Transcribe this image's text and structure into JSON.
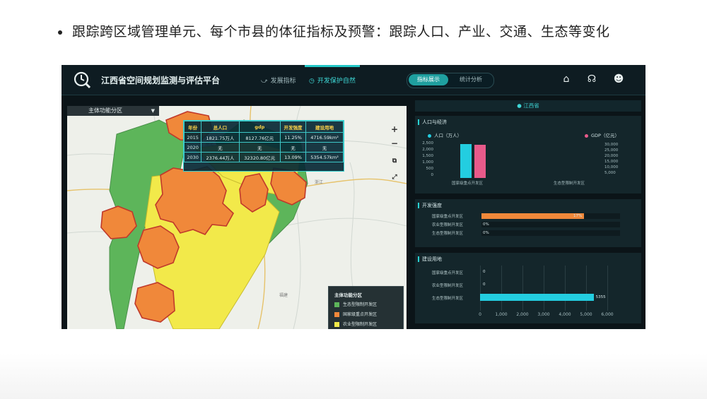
{
  "slide": {
    "bullet_text": "跟踪跨区域管理单元、每个市县的体征指标及预警：跟踪人口、产业、交通、生态等变化"
  },
  "app": {
    "title": "江西省空间规划监测与评估平台",
    "nav_tabs": [
      {
        "label": "发展指标",
        "icon": "trend-icon",
        "active": false
      },
      {
        "label": "开发保护自然",
        "icon": "clock-icon",
        "active": true
      }
    ],
    "segments": [
      {
        "label": "指标展示",
        "active": true
      },
      {
        "label": "统计分析",
        "active": false
      }
    ],
    "top_icons": [
      "home-icon",
      "support-icon",
      "user-icon"
    ],
    "colors": {
      "accent": "#23c7c7",
      "green": "#5db55a",
      "orange": "#f0883a",
      "yellow": "#f2e94a",
      "pink": "#e85a8a",
      "cyan": "#23cde0"
    }
  },
  "map": {
    "layer_select": "主体功能分区",
    "controls": [
      "+",
      "−"
    ],
    "table": {
      "headers": [
        "年份",
        "总人口",
        "gdp",
        "开发强度",
        "建设用地"
      ],
      "rows": [
        [
          "2015",
          "1821.75万人",
          "8127.76亿元",
          "11.25%",
          "4716.59km²"
        ],
        [
          "2020",
          "无",
          "无",
          "无",
          "无"
        ],
        [
          "2030",
          "2376.44万人",
          "32320.80亿元",
          "13.09%",
          "5354.57km²"
        ]
      ]
    },
    "legend": {
      "title": "主体功能分区",
      "items": [
        {
          "label": "生态型限制开发区",
          "color": "#5db55a"
        },
        {
          "label": "国家级重点开发区",
          "color": "#f0883a"
        },
        {
          "label": "农业型限制开发区",
          "color": "#f2e94a"
        }
      ]
    }
  },
  "right_panel": {
    "region": "江西省",
    "population_panel": {
      "title": "人口与经济",
      "legend_left": "人口（万人）",
      "legend_right": "GDP（亿元）",
      "y_left_ticks": [
        "2,500",
        "2,000",
        "1,500",
        "1,000",
        "500",
        "0"
      ],
      "y_right_ticks": [
        "30,000",
        "25,000",
        "20,000",
        "15,000",
        "10,000",
        "5,000"
      ],
      "x_labels": [
        "国家级重点开发区",
        "生态型限制开发区"
      ]
    },
    "dev_panel": {
      "title": "开发强度",
      "rows": [
        {
          "label": "国家级重点开发区",
          "value": "17%"
        },
        {
          "label": "农业型限制开发区",
          "value": "0%"
        },
        {
          "label": "生态型限制开发区",
          "value": "0%"
        }
      ]
    },
    "build_panel": {
      "title": "建设用地",
      "rows": [
        {
          "label": "国家级重点开发区",
          "value": "0"
        },
        {
          "label": "农业型限制开发区",
          "value": "0"
        },
        {
          "label": "生态型限制开发区",
          "value": "5355"
        }
      ],
      "x_ticks": [
        "0",
        "1,000",
        "2,000",
        "3,000",
        "4,000",
        "5,000",
        "6,000"
      ]
    }
  },
  "chart_data": [
    {
      "type": "bar",
      "title": "人口与经济",
      "categories": [
        "国家级重点开发区",
        "生态型限制开发区"
      ],
      "series": [
        {
          "name": "人口（万人）",
          "values": [
            2300,
            null
          ],
          "color": "#23cde0"
        },
        {
          "name": "GDP（亿元）",
          "values": [
            27000,
            null
          ],
          "color": "#e85a8a"
        }
      ],
      "ylim_left": [
        0,
        2500
      ],
      "ylim_right": [
        0,
        30000
      ]
    },
    {
      "type": "bar",
      "title": "开发强度",
      "orientation": "horizontal",
      "categories": [
        "国家级重点开发区",
        "农业型限制开发区",
        "生态型限制开发区"
      ],
      "values": [
        17,
        0,
        0
      ],
      "xlim": [
        0,
        23
      ]
    },
    {
      "type": "bar",
      "title": "建设用地",
      "orientation": "horizontal",
      "categories": [
        "国家级重点开发区",
        "农业型限制开发区",
        "生态型限制开发区"
      ],
      "values": [
        0,
        0,
        5355
      ],
      "xlim": [
        0,
        6000
      ]
    }
  ]
}
